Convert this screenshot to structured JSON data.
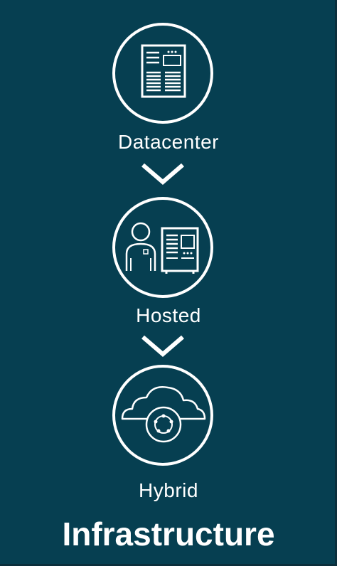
{
  "steps": [
    {
      "label": "Datacenter",
      "icon": "server-rack-icon"
    },
    {
      "label": "Hosted",
      "icon": "person-with-server-icon"
    },
    {
      "label": "Hybrid",
      "icon": "cloud-network-icon"
    }
  ],
  "title": "Infrastructure",
  "colors": {
    "background": "#063f51",
    "foreground": "#ffffff"
  }
}
